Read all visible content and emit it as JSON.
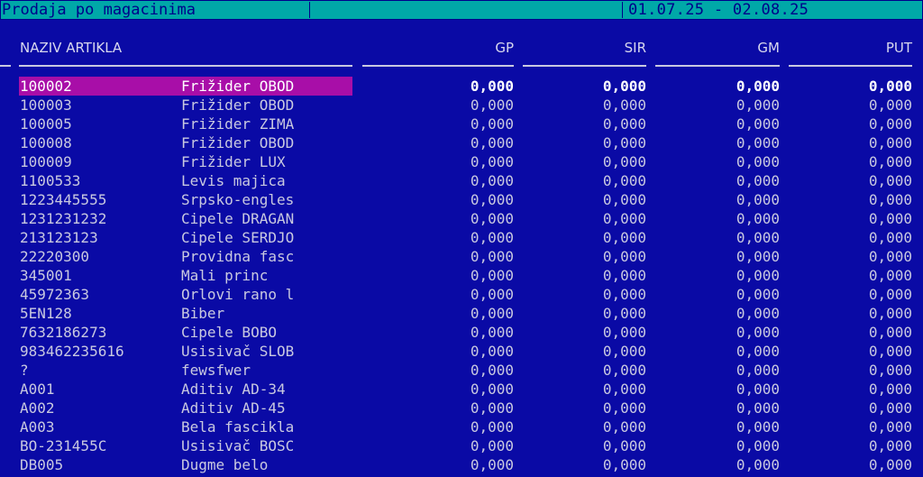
{
  "header": {
    "title": "Prodaja po magacinima",
    "date_range": "01.07.25 - 02.08.25"
  },
  "columns": {
    "naziv": "NAZIV ARTIKLA",
    "gp": "GP",
    "sir": "SIR",
    "gm": "GM",
    "put": "PUT"
  },
  "rows": [
    {
      "code": "100002",
      "name": "Frižider OBOD",
      "gp": "0,000",
      "sir": "0,000",
      "gm": "0,000",
      "put": "0,000"
    },
    {
      "code": "100003",
      "name": "Frižider OBOD",
      "gp": "0,000",
      "sir": "0,000",
      "gm": "0,000",
      "put": "0,000"
    },
    {
      "code": "100005",
      "name": "Frižider ZIMA",
      "gp": "0,000",
      "sir": "0,000",
      "gm": "0,000",
      "put": "0,000"
    },
    {
      "code": "100008",
      "name": "Frižider OBOD",
      "gp": "0,000",
      "sir": "0,000",
      "gm": "0,000",
      "put": "0,000"
    },
    {
      "code": "100009",
      "name": "Frižider LUX",
      "gp": "0,000",
      "sir": "0,000",
      "gm": "0,000",
      "put": "0,000"
    },
    {
      "code": "1100533",
      "name": "Levis majica",
      "gp": "0,000",
      "sir": "0,000",
      "gm": "0,000",
      "put": "0,000"
    },
    {
      "code": "1223445555",
      "name": "Srpsko-engles",
      "gp": "0,000",
      "sir": "0,000",
      "gm": "0,000",
      "put": "0,000"
    },
    {
      "code": "1231231232",
      "name": "Cipele DRAGAN",
      "gp": "0,000",
      "sir": "0,000",
      "gm": "0,000",
      "put": "0,000"
    },
    {
      "code": "213123123",
      "name": "Cipele SERDJO",
      "gp": "0,000",
      "sir": "0,000",
      "gm": "0,000",
      "put": "0,000"
    },
    {
      "code": "22220300",
      "name": "Providna fasc",
      "gp": "0,000",
      "sir": "0,000",
      "gm": "0,000",
      "put": "0,000"
    },
    {
      "code": "345001",
      "name": "Mali princ",
      "gp": "0,000",
      "sir": "0,000",
      "gm": "0,000",
      "put": "0,000"
    },
    {
      "code": "45972363",
      "name": "Orlovi rano l",
      "gp": "0,000",
      "sir": "0,000",
      "gm": "0,000",
      "put": "0,000"
    },
    {
      "code": "5EN128",
      "name": "Biber",
      "gp": "0,000",
      "sir": "0,000",
      "gm": "0,000",
      "put": "0,000"
    },
    {
      "code": "7632186273",
      "name": "Cipele BOBO",
      "gp": "0,000",
      "sir": "0,000",
      "gm": "0,000",
      "put": "0,000"
    },
    {
      "code": "983462235616",
      "name": "Usisivač SLOB",
      "gp": "0,000",
      "sir": "0,000",
      "gm": "0,000",
      "put": "0,000"
    },
    {
      "code": "?",
      "name": "fewsfwer",
      "gp": "0,000",
      "sir": "0,000",
      "gm": "0,000",
      "put": "0,000"
    },
    {
      "code": "A001",
      "name": "Aditiv AD-34",
      "gp": "0,000",
      "sir": "0,000",
      "gm": "0,000",
      "put": "0,000"
    },
    {
      "code": "A002",
      "name": "Aditiv AD-45",
      "gp": "0,000",
      "sir": "0,000",
      "gm": "0,000",
      "put": "0,000"
    },
    {
      "code": "A003",
      "name": "Bela fascikla",
      "gp": "0,000",
      "sir": "0,000",
      "gm": "0,000",
      "put": "0,000"
    },
    {
      "code": "BO-231455C",
      "name": "Usisivač BOSC",
      "gp": "0,000",
      "sir": "0,000",
      "gm": "0,000",
      "put": "0,000"
    },
    {
      "code": "DB005",
      "name": "Dugme belo",
      "gp": "0,000",
      "sir": "0,000",
      "gm": "0,000",
      "put": "0,000"
    }
  ],
  "colors": {
    "background": "#0a0aa5",
    "titlebar": "#00a8a8",
    "selection": "#a80ea8",
    "text": "#c9c9e0"
  }
}
